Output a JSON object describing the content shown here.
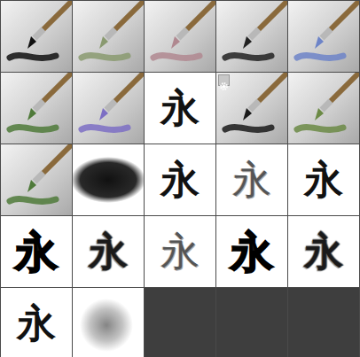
{
  "presets": [
    {
      "kind": "tool",
      "color": "#111111",
      "badge": false,
      "selected": false
    },
    {
      "kind": "tool",
      "color": "#8a9a70",
      "badge": false,
      "selected": false
    },
    {
      "kind": "tool",
      "color": "#b08890",
      "badge": false,
      "selected": false
    },
    {
      "kind": "tool",
      "color": "#222222",
      "badge": false,
      "selected": false
    },
    {
      "kind": "tool",
      "color": "#6d84c8",
      "badge": false,
      "selected": false
    },
    {
      "kind": "tool",
      "color": "#4f7a3a",
      "badge": false,
      "selected": false
    },
    {
      "kind": "tool",
      "color": "#7d6fc4",
      "badge": false,
      "selected": false
    },
    {
      "kind": "glyph",
      "text": "永",
      "badge": false,
      "selected": false
    },
    {
      "kind": "tool",
      "color": "#1a1a1a",
      "badge": true,
      "selected": false
    },
    {
      "kind": "tool",
      "color": "#6b8a45",
      "badge": false,
      "selected": false
    },
    {
      "kind": "tool",
      "color": "#4f7a3a",
      "badge": false,
      "selected": false
    },
    {
      "kind": "ink",
      "color": "#111111",
      "badge": false,
      "selected": false
    },
    {
      "kind": "glyph",
      "text": "永",
      "badge": false,
      "selected": false
    },
    {
      "kind": "dry",
      "text": "永",
      "badge": false,
      "selected": false
    },
    {
      "kind": "glyph",
      "text": "永",
      "badge": false,
      "selected": false
    },
    {
      "kind": "heavy",
      "text": "永",
      "badge": false,
      "selected": false
    },
    {
      "kind": "rough",
      "text": "永",
      "badge": false,
      "selected": false
    },
    {
      "kind": "dry",
      "text": "永",
      "badge": false,
      "selected": false
    },
    {
      "kind": "heavy",
      "text": "永",
      "badge": false,
      "selected": false
    },
    {
      "kind": "rough",
      "text": "永",
      "badge": false,
      "selected": false
    },
    {
      "kind": "glyph",
      "text": "永",
      "badge": false,
      "selected": false
    },
    {
      "kind": "soft",
      "color": "#666666",
      "badge": false,
      "selected": false
    }
  ]
}
